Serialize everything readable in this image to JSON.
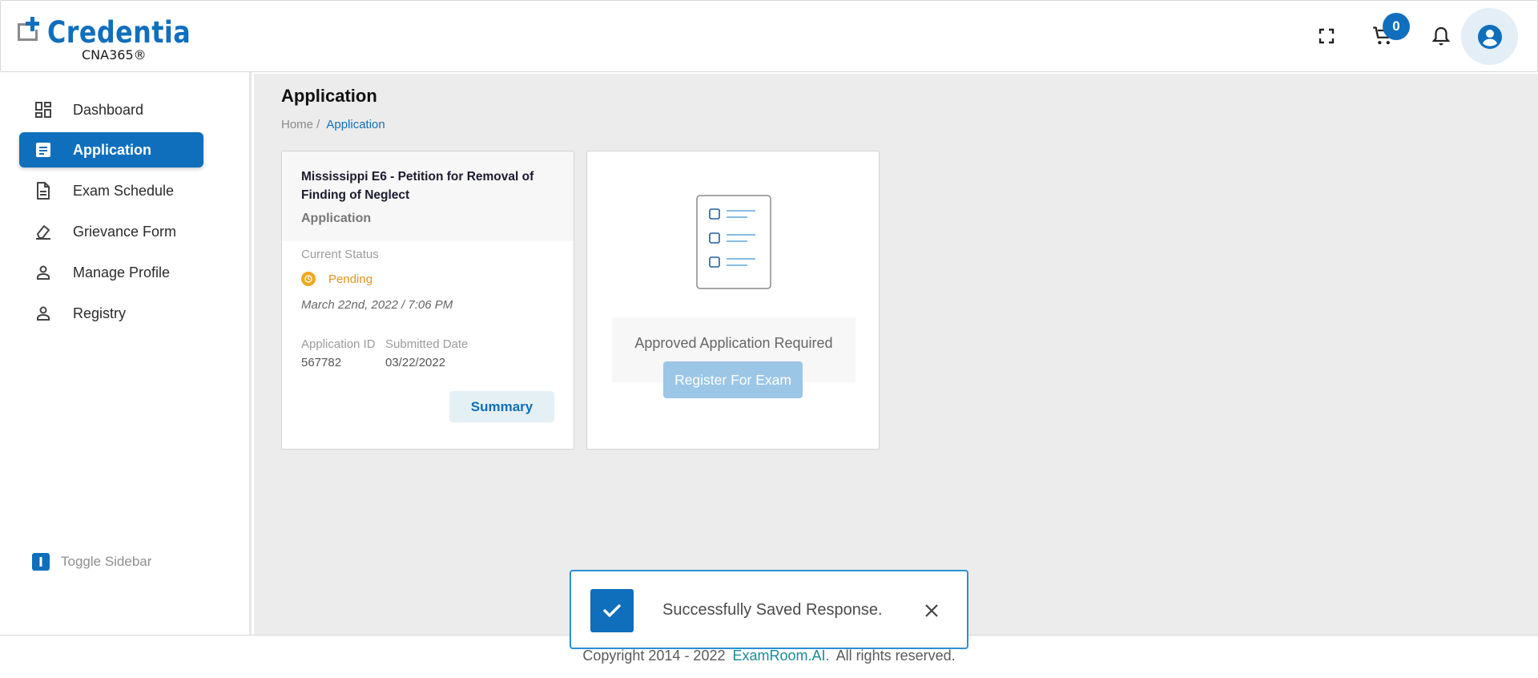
{
  "brand": {
    "name": "Credentia",
    "sub": "CNA365®",
    "color": "#0f6fbd"
  },
  "header": {
    "cart_count": "0",
    "icons": [
      "fullscreen-icon",
      "cart-icon",
      "bell-icon",
      "account-icon"
    ]
  },
  "sidebar": {
    "items": [
      {
        "label": "Dashboard",
        "icon": "dashboard-icon",
        "active": false
      },
      {
        "label": "Application",
        "icon": "application-icon",
        "active": true
      },
      {
        "label": "Exam Schedule",
        "icon": "document-icon",
        "active": false
      },
      {
        "label": "Grievance Form",
        "icon": "eraser-icon",
        "active": false
      },
      {
        "label": "Manage Profile",
        "icon": "person-icon",
        "active": false
      },
      {
        "label": "Registry",
        "icon": "person-icon",
        "active": false
      }
    ],
    "toggle_label": "Toggle Sidebar"
  },
  "main": {
    "title": "Application",
    "breadcrumb": {
      "home": "Home /",
      "current": "Application"
    }
  },
  "application_card": {
    "title": "Mississippi E6 - Petition for Removal of Finding of Neglect",
    "subtitle": "Application",
    "status_label": "Current Status",
    "status": "Pending",
    "status_color": "#e39320",
    "datetime": "March 22nd, 2022 / 7:06 PM",
    "id_label": "Application ID",
    "id_value": "567782",
    "submitted_label": "Submitted Date",
    "submitted_value": "03/22/2022",
    "summary_label": "Summary"
  },
  "exam_card": {
    "approved_text": "Approved Application Required",
    "register_label": "Register For Exam"
  },
  "footer": {
    "prefix": "Copyright 2014 - 2022",
    "link": "ExamRoom.AI.",
    "suffix": "All rights reserved."
  },
  "toast": {
    "message": "Successfully Saved Response."
  }
}
